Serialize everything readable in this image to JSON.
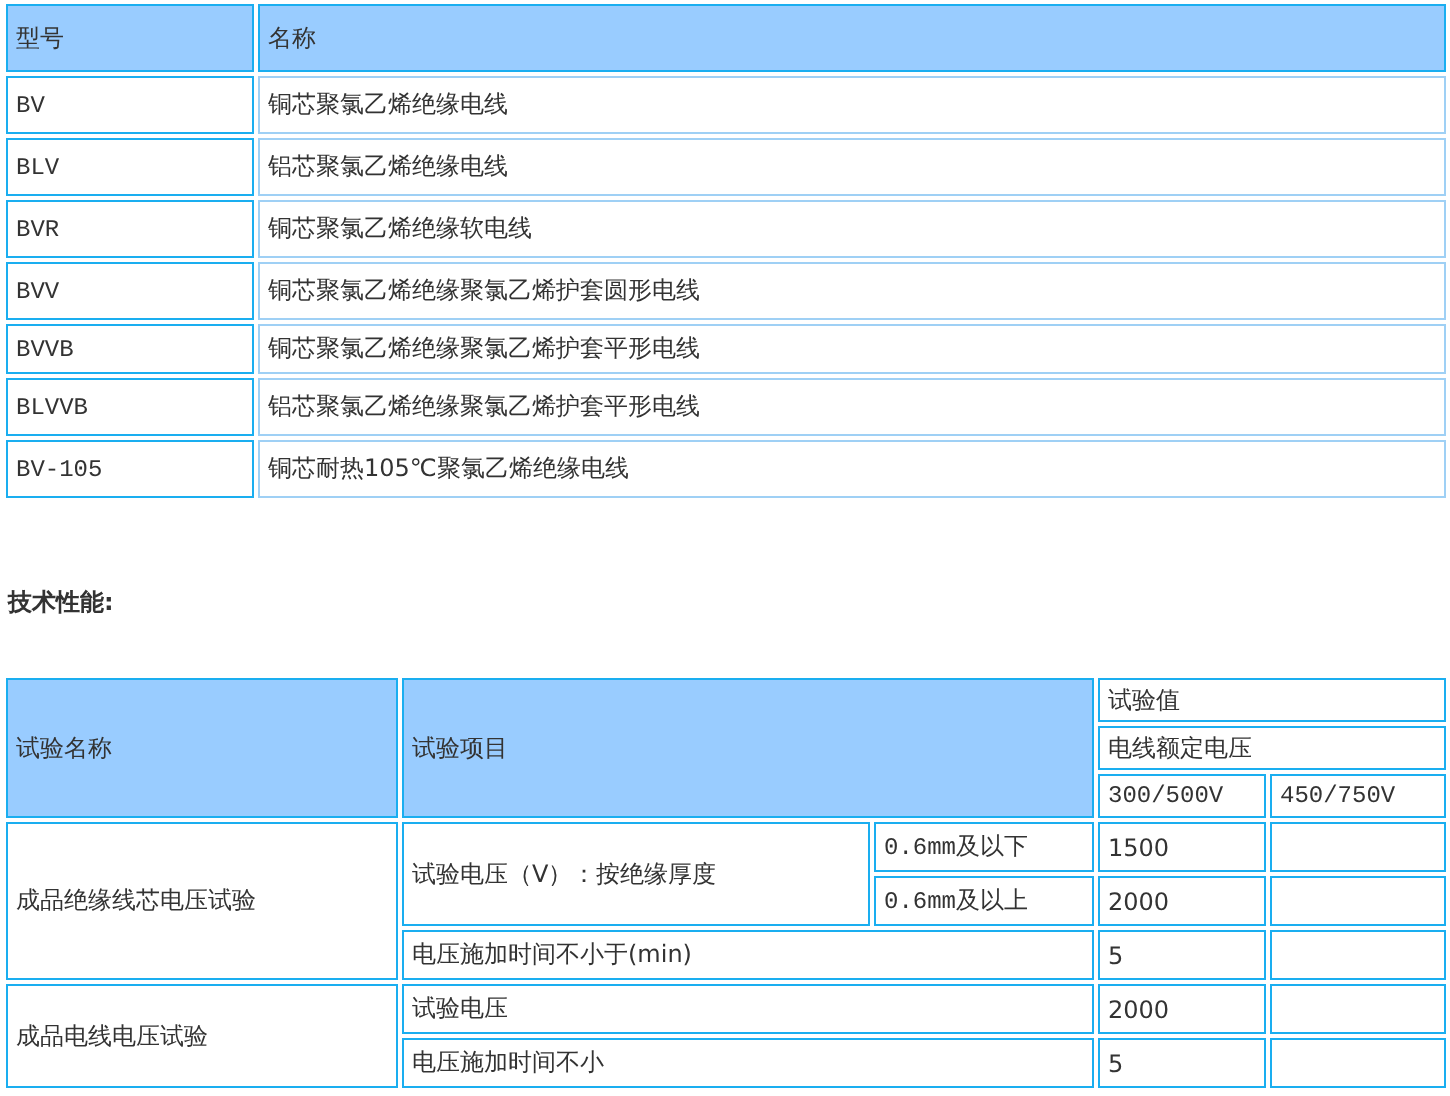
{
  "model_table": {
    "columns": [
      "型号",
      "名称"
    ],
    "rows": [
      {
        "model": "BV",
        "name": "铜芯聚氯乙烯绝缘电线"
      },
      {
        "model": "BLV",
        "name": "铝芯聚氯乙烯绝缘电线"
      },
      {
        "model": "BVR",
        "name": "铜芯聚氯乙烯绝缘软电线"
      },
      {
        "model": "BVV",
        "name": "铜芯聚氯乙烯绝缘聚氯乙烯护套圆形电线"
      },
      {
        "model": "BVVB",
        "name": "铜芯聚氯乙烯绝缘聚氯乙烯护套平形电线"
      },
      {
        "model": "BLVVB",
        "name": "铝芯聚氯乙烯绝缘聚氯乙烯护套平形电线"
      },
      {
        "model": "BV-105",
        "name": "铜芯耐热105℃聚氯乙烯绝缘电线"
      }
    ]
  },
  "section_heading": "技术性能:",
  "test_table": {
    "header": {
      "test_name": "试验名称",
      "test_item": "试验项目",
      "values_title": "试验值",
      "voltage_title": "电线额定电压",
      "voltages": [
        "300/500V",
        "450/750V"
      ]
    },
    "groups": [
      {
        "name": "成品绝缘线芯电压试验",
        "items": [
          {
            "label": "试验电压（V）：按绝缘厚度",
            "conditions": [
              {
                "condition": "0.6mm及以下",
                "values": [
                  "1500"
                ]
              },
              {
                "condition": "0.6mm及以上",
                "values": [
                  "2000"
                ]
              }
            ]
          },
          {
            "label": "电压施加时间不小于(min)",
            "values": [
              "5"
            ]
          }
        ]
      },
      {
        "name": "成品电线电压试验",
        "items": [
          {
            "label": "试验电压",
            "values": [
              "2000"
            ]
          },
          {
            "label": "电压施加时间不小",
            "values": [
              "5"
            ]
          }
        ]
      }
    ]
  }
}
